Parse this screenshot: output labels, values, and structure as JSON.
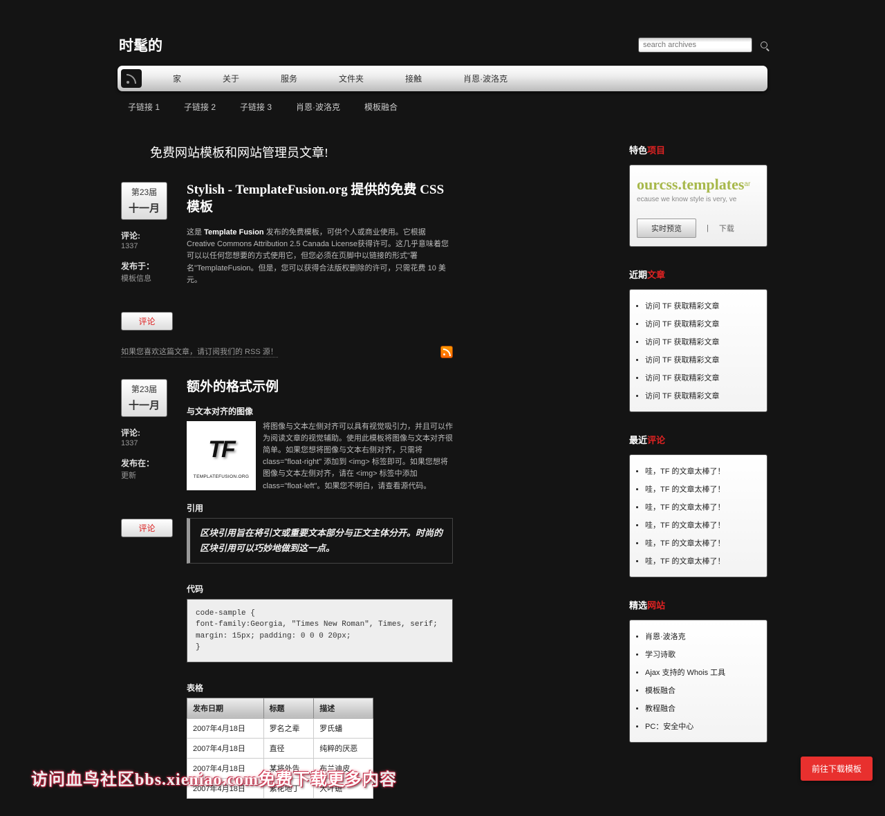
{
  "site": {
    "title": "时髦的",
    "tagline": "免费网站模板和网站管理员文章!"
  },
  "search": {
    "placeholder": "search archives"
  },
  "nav": [
    "家",
    "关于",
    "服务",
    "文件夹",
    "接触",
    "肖恩·波洛克"
  ],
  "subnav": [
    "子链接 1",
    "子链接 2",
    "子链接 3",
    "肖恩·波洛克",
    "模板融合"
  ],
  "post1": {
    "day": "第23届",
    "month": "十一月",
    "comments_label": "评论:",
    "comments": "1337",
    "pub_label": "发布于：",
    "pub": "模板信息",
    "title": "Stylish - TemplateFusion.org 提供的免费 CSS 模板",
    "body_a": "这是 ",
    "body_b": "Template Fusion",
    "body_c": " 发布的免费模板，可供个人或商业使用。它根据Creative Commons Attribution 2.5 Canada License获得许可。这几乎意味着您可以以任何您想要的方式使用它，但您必须在页脚中以链接的形式\"署名\"TemplateFusion。但是，您可以获得合法版权删除的许可，只需花费 10 美元。",
    "comment_btn": "评论",
    "footer_link": "如果您喜欢这篇文章，请订阅我们的 RSS 源！"
  },
  "post2": {
    "day": "第23届",
    "month": "十一月",
    "comments_label": "评论:",
    "comments": "1337",
    "pub_label": "发布在：",
    "pub": "更新",
    "title": "额外的格式示例",
    "h_img": "与文本对齐的图像",
    "img_text": "将图像与文本左侧对齐可以具有视觉吸引力，并且可以作为阅读文章的视觉辅助。使用此模板将图像与文本对齐很简单。如果您想将图像与文本右侧对齐，只需将 class=\"float-right\" 添加到 <img> 标签即可。如果您想将图像与文本左侧对齐，请在 <img> 标签中添加 class=\"float-left\"。如果您不明白，请查看源代码。",
    "h_quote": "引用",
    "quote": "区块引用旨在将引文或重要文本部分与正文主体分开。时尚的区块引用可以巧妙地做到这一点。",
    "h_code": "代码",
    "code": "code-sample {\nfont-family:Georgia, \"Times New Roman\", Times, serif;\nmargin: 15px; padding: 0 0 0 20px;\n}",
    "h_table": "表格",
    "table": {
      "h1": "发布日期",
      "h2": "标题",
      "h3": "描述",
      "rows": [
        [
          "2007年4月18日",
          "罗名之辈",
          "罗氏蟠"
        ],
        [
          "2007年4月18日",
          "直径",
          "纯粹的厌恶"
        ],
        [
          "2007年4月18日",
          "某将外告",
          "布兰迪皮"
        ],
        [
          "2007年4月18日",
          "紫花地丁",
          "大叶蟾"
        ]
      ]
    },
    "comment_btn": "评论"
  },
  "side": {
    "featured": {
      "t1": "特色",
      "t2": "项目",
      "brand": "ourcss.templates",
      "tag": "ecause we know style is very, ve",
      "preview": "实时预览",
      "sep": "|",
      "download": "下载"
    },
    "recent_posts": {
      "t1": "近期",
      "t2": "文章",
      "items": [
        "访问 TF 获取精彩文章",
        "访问 TF 获取精彩文章",
        "访问 TF 获取精彩文章",
        "访问 TF 获取精彩文章",
        "访问 TF 获取精彩文章",
        "访问 TF 获取精彩文章"
      ]
    },
    "recent_comments": {
      "t1": "最近",
      "t2": "评论",
      "items": [
        "哇，TF 的文章太棒了！",
        "哇，TF 的文章太棒了！",
        "哇，TF 的文章太棒了！",
        "哇，TF 的文章太棒了！",
        "哇，TF 的文章太棒了！",
        "哇，TF 的文章太棒了！"
      ]
    },
    "featured_sites": {
      "t1": "精选",
      "t2": "网站",
      "items": [
        "肖恩·波洛克",
        "学习诗歌",
        "Ajax 支持的 Whois 工具",
        "模板融合",
        "教程融合",
        "PC：安全中心"
      ]
    }
  },
  "download_btn": "前往下载模板",
  "watermark": "访问血鸟社区bbs.xieniao.com免费下载更多内容"
}
